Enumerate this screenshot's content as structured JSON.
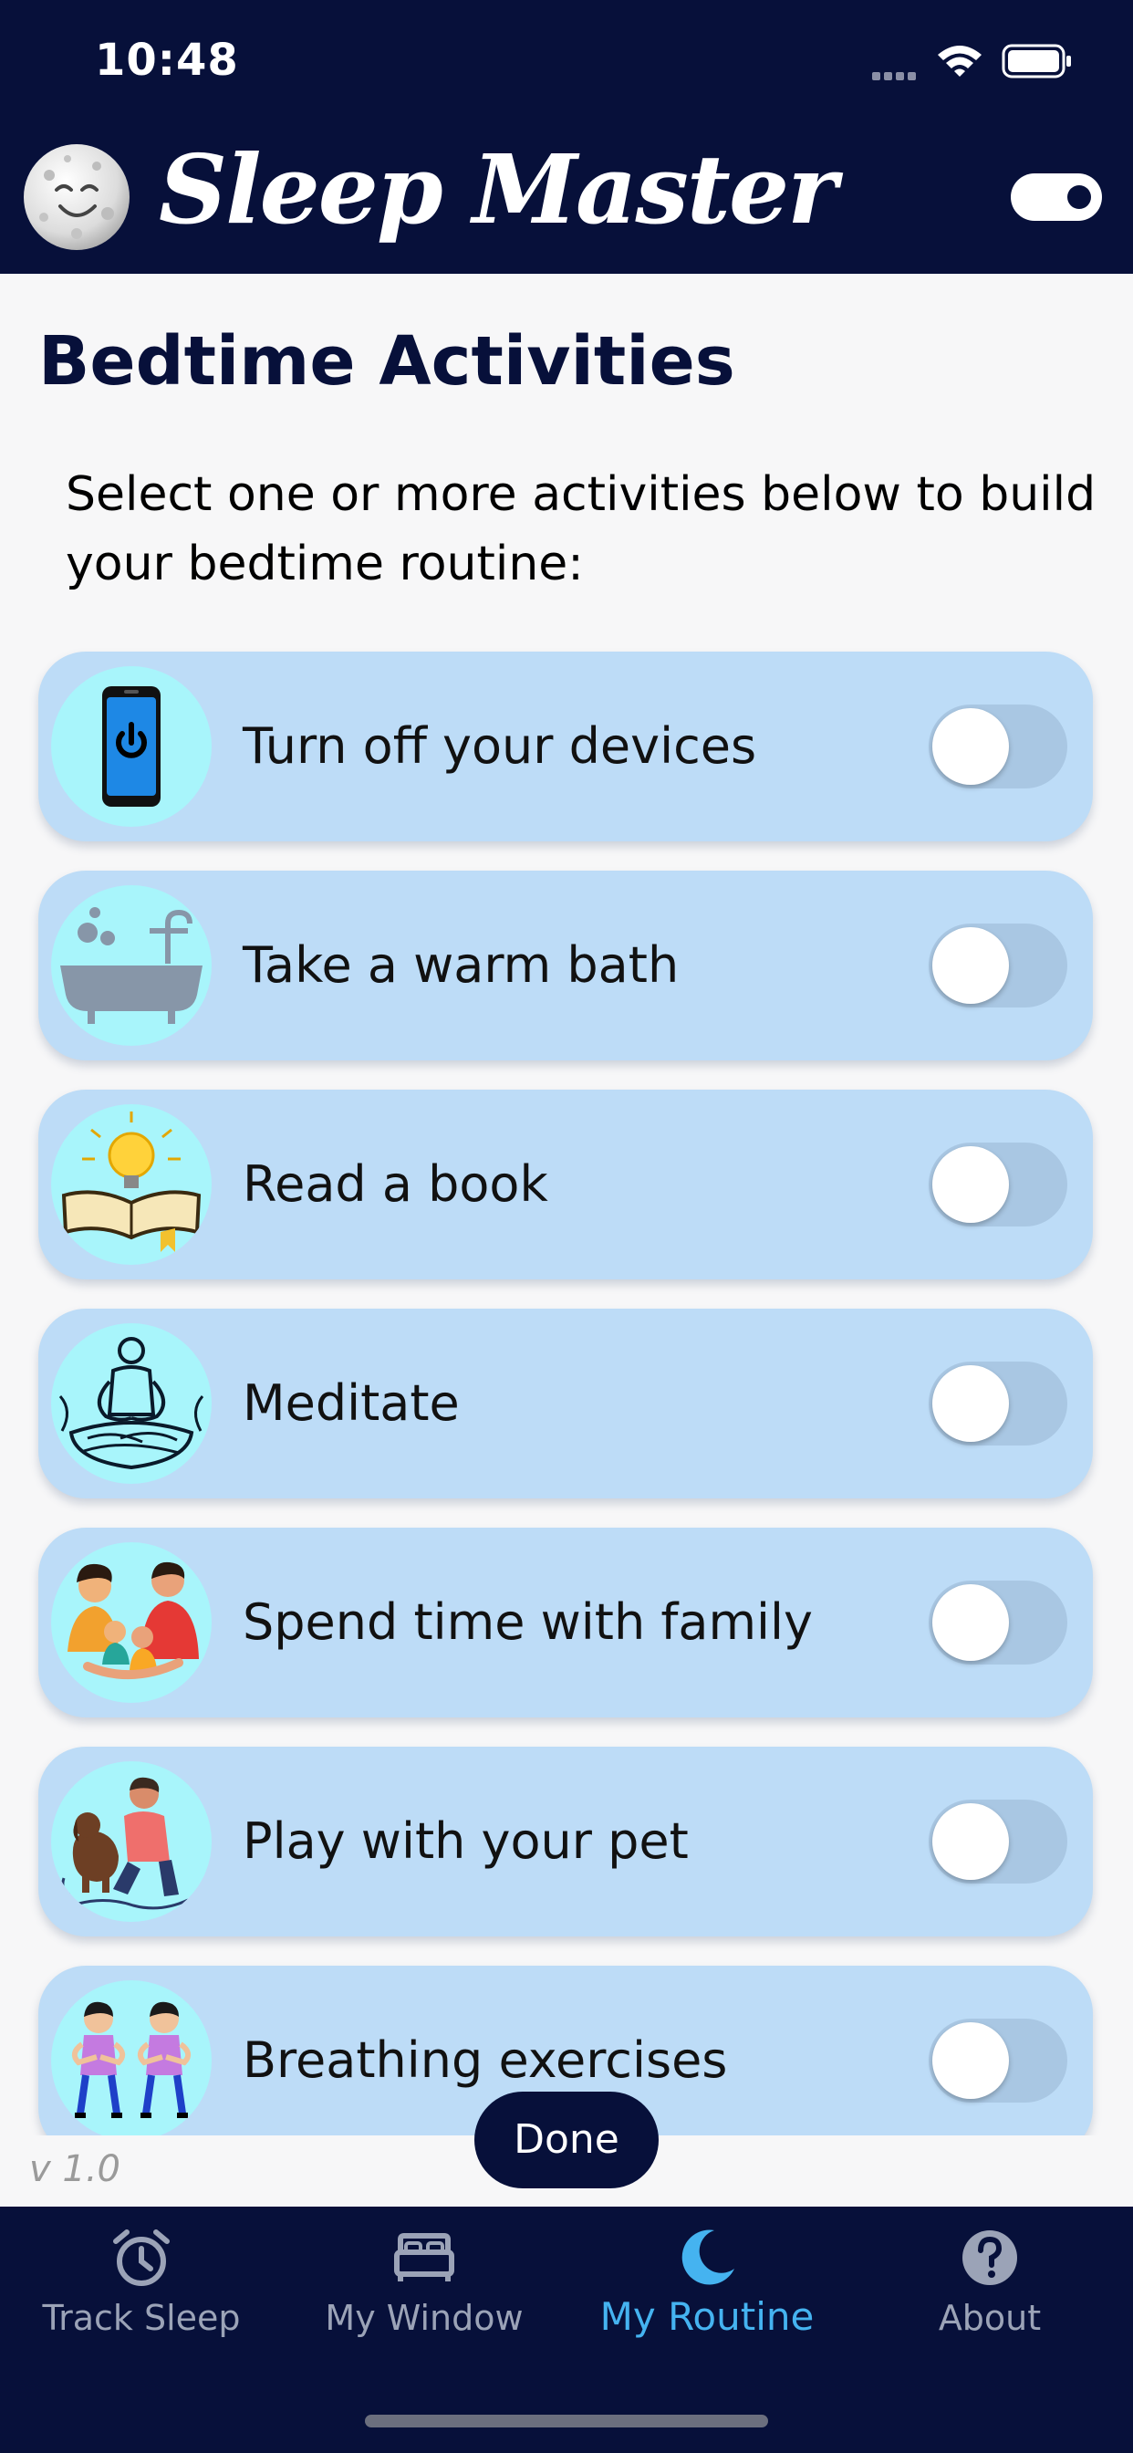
{
  "status_bar": {
    "time": "10:48"
  },
  "header": {
    "app_title": "Sleep Master"
  },
  "page": {
    "title": "Bedtime Activities",
    "intro": "Select one or more activities below to build your bedtime routine:"
  },
  "activities": [
    {
      "label": "Turn off your devices",
      "icon": "phone-power-icon",
      "enabled": false
    },
    {
      "label": "Take a warm bath",
      "icon": "bathtub-icon",
      "enabled": false
    },
    {
      "label": "Read a book",
      "icon": "book-lightbulb-icon",
      "enabled": false
    },
    {
      "label": "Meditate",
      "icon": "meditation-icon",
      "enabled": false
    },
    {
      "label": "Spend time with family",
      "icon": "family-icon",
      "enabled": false
    },
    {
      "label": "Play with your pet",
      "icon": "pet-icon",
      "enabled": false
    },
    {
      "label": "Breathing exercises",
      "icon": "breathing-kids-icon",
      "enabled": false
    }
  ],
  "footer": {
    "done_label": "Done",
    "version": "v 1.0"
  },
  "tabs": [
    {
      "label": "Track Sleep",
      "icon": "alarm-clock-icon",
      "active": false
    },
    {
      "label": "My Window",
      "icon": "bed-icon",
      "active": false
    },
    {
      "label": "My Routine",
      "icon": "moon-icon",
      "active": true
    },
    {
      "label": "About",
      "icon": "question-icon",
      "active": false
    }
  ],
  "colors": {
    "navy": "#07103a",
    "card": "#bddcf7",
    "icon_bg": "#a8f5fb",
    "accent": "#45b3f0"
  }
}
